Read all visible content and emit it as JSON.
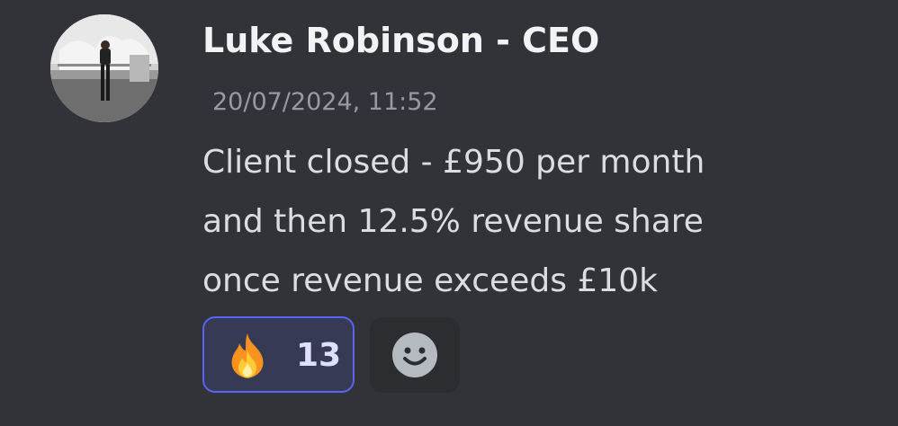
{
  "message": {
    "author": "Luke Robinson - CEO",
    "timestamp": "20/07/2024, 11:52",
    "content_lines": [
      "Client closed - £950 per month",
      "and then 12.5% revenue share",
      "once revenue exceeds £10k"
    ],
    "avatar_icon": "user-avatar-photo"
  },
  "reactions": [
    {
      "emoji_icon": "fire-emoji-icon",
      "count": "13",
      "active": true
    }
  ],
  "add_reaction": {
    "icon": "smile-face-icon"
  },
  "colors": {
    "background": "#313338",
    "author": "#f2f3f5",
    "timestamp": "#949ba4",
    "content": "#dbdee1",
    "reaction_border": "#5865f2",
    "reaction_bg": "#373a55",
    "add_reaction_bg": "#2b2d31"
  }
}
